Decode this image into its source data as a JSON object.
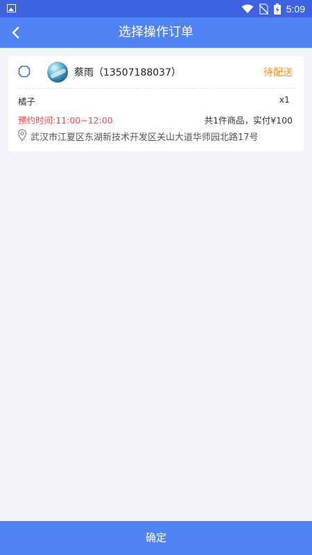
{
  "status_bar": {
    "time": "5:09"
  },
  "nav": {
    "title": "选择操作订单",
    "back_icon": "chevron-left-icon"
  },
  "order": {
    "customer": "蔡雨（13507188037）",
    "status": "待配送",
    "item_name": "橘子",
    "item_qty": "x1",
    "appointment": "预约时间:11:00~12:00",
    "summary": "共1件商品，实付¥100",
    "address": "武汉市江夏区东湖新技术开发区关山大道华师园北路17号"
  },
  "footer": {
    "confirm_label": "确定"
  },
  "colors": {
    "status_bar": "#3d63e0",
    "nav_bar": "#5084f6",
    "status_text": "#f7901e",
    "appointment_text": "#f04848",
    "background": "#f3f4f8"
  }
}
